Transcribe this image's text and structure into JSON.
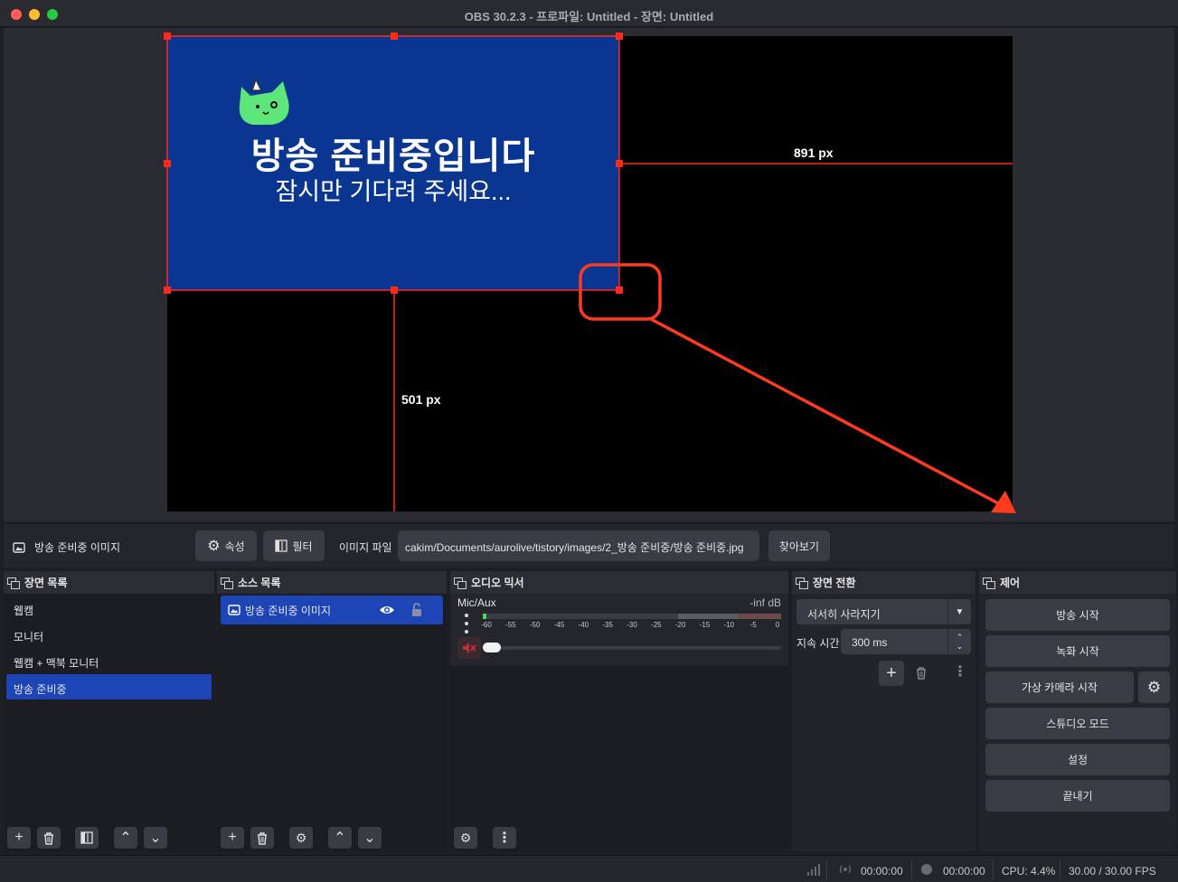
{
  "window": {
    "title": "OBS 30.2.3 - 프로파일: Untitled - 장면: Untitled"
  },
  "preview": {
    "image_headline": "방송 준비중입니다",
    "image_subline": "잠시만 기다려 주세요...",
    "dim_right": "891 px",
    "dim_bottom": "501 px",
    "highlight_color": "#ff3b1f",
    "image_bg_color": "#0a3590",
    "mascot_color": "#5de67a"
  },
  "properties_bar": {
    "source_name": "방송 준비중 이미지",
    "properties_label": "속성",
    "filters_label": "필터",
    "image_file_label": "이미지 파일",
    "image_file_path": "cakim/Documents/aurolive/tistory/images/2_방송 준비중/방송 준비중.jpg",
    "browse_label": "찾아보기"
  },
  "scenes": {
    "title": "장면 목록",
    "items": [
      "웹캠",
      "모니터",
      "웹캠 + 맥북 모니터",
      "방송 준비중"
    ],
    "active_index": 3
  },
  "sources": {
    "title": "소스 목록",
    "items": [
      "방송 준비중 이미지"
    ]
  },
  "audio_mixer": {
    "title": "오디오 믹서",
    "track_name": "Mic/Aux",
    "track_level": "-inf dB",
    "ticks": [
      "-60",
      "-55",
      "-50",
      "-45",
      "-40",
      "-35",
      "-30",
      "-25",
      "-20",
      "-15",
      "-10",
      "-5",
      "0"
    ],
    "muted": true
  },
  "transitions": {
    "title": "장면 전환",
    "selected": "서서히 사라지기",
    "duration_label": "지속 시간",
    "duration_value": "300 ms"
  },
  "controls": {
    "title": "제어",
    "start_streaming": "방송 시작",
    "start_recording": "녹화 시작",
    "start_virtual_camera": "가상 카메라 시작",
    "studio_mode": "스튜디오 모드",
    "settings": "설정",
    "exit": "끝내기"
  },
  "status": {
    "stream_time": "00:00:00",
    "record_time": "00:00:00",
    "cpu": "CPU: 4.4%",
    "fps": "30.00 / 30.00 FPS"
  }
}
